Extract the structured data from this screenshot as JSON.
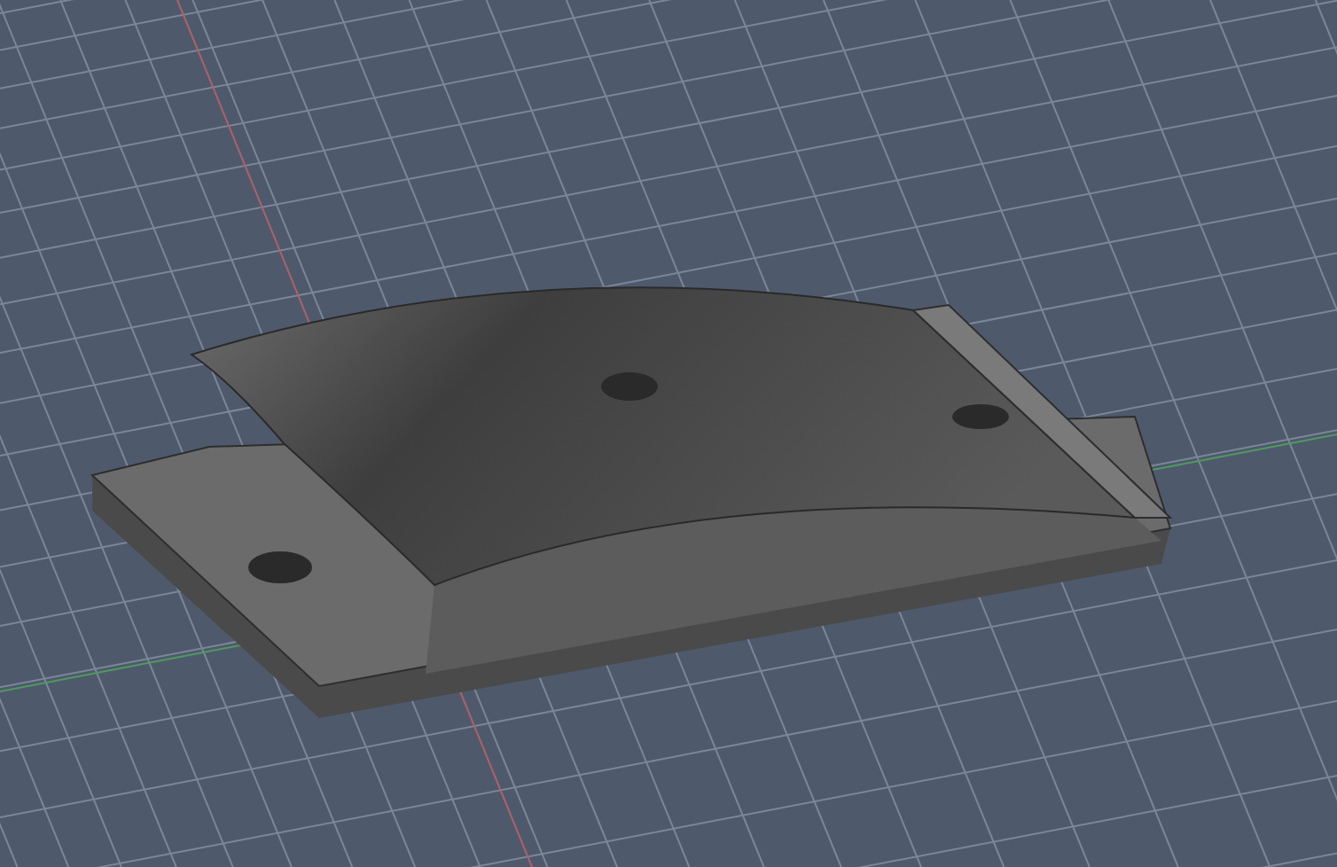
{
  "scene": {
    "grid_visible": true,
    "axes_visible": true
  }
}
